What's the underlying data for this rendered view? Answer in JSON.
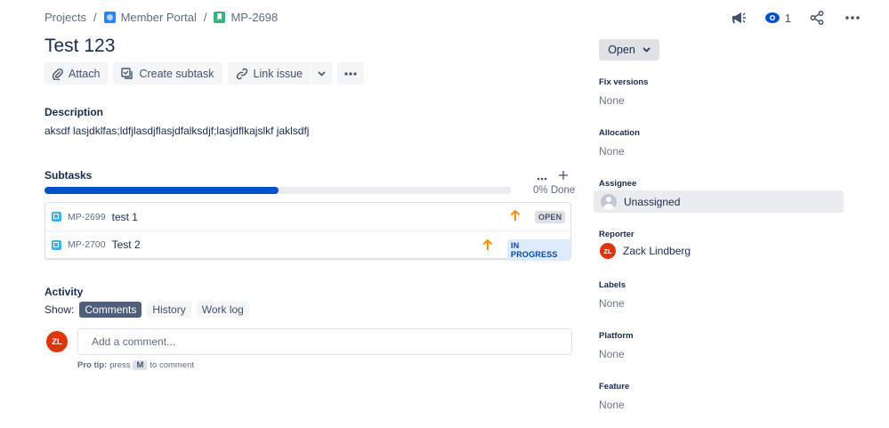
{
  "breadcrumb": {
    "projects": "Projects",
    "project": "Member Portal",
    "issue_key": "MP-2698"
  },
  "header": {
    "watch_count": "1"
  },
  "issue": {
    "title": "Test 123"
  },
  "toolbar": {
    "attach": "Attach",
    "create_subtask": "Create subtask",
    "link_issue": "Link issue"
  },
  "description": {
    "label": "Description",
    "text": "aksdf lasjdklfas;ldfjlasdjflasjdfalksdjf;lasjdflkajslkf jaklsdfj"
  },
  "subtasks": {
    "label": "Subtasks",
    "done_text": "0% Done",
    "progress_fraction": 0.5,
    "items": [
      {
        "key": "MP-2699",
        "summary": "test 1",
        "status": "OPEN",
        "priority": "high",
        "status_color": "#42526E",
        "status_bg": "#DFE1E6"
      },
      {
        "key": "MP-2700",
        "summary": "Test 2",
        "status": "IN PROGRESS",
        "priority": "high",
        "status_color": "#0747A6",
        "status_bg": "#DEEBFF"
      }
    ]
  },
  "activity": {
    "label": "Activity",
    "show_label": "Show:",
    "filters": [
      "Comments",
      "History",
      "Work log"
    ],
    "active_filter": "Comments",
    "comment_placeholder": "Add a comment...",
    "user_initials": "ZL",
    "protip_label": "Pro tip:",
    "protip_press": "press",
    "protip_key": "M",
    "protip_suffix": "to comment"
  },
  "sidebar": {
    "status": "Open",
    "fields": {
      "fix_versions": {
        "label": "Fix versions",
        "value": "None"
      },
      "allocation": {
        "label": "Allocation",
        "value": "None"
      },
      "assignee": {
        "label": "Assignee",
        "value": "Unassigned"
      },
      "reporter": {
        "label": "Reporter",
        "value": "Zack Lindberg",
        "initials": "ZL"
      },
      "labels": {
        "label": "Labels",
        "value": "None"
      },
      "platform": {
        "label": "Platform",
        "value": "None"
      },
      "feature": {
        "label": "Feature",
        "value": "None"
      }
    }
  },
  "colors": {
    "accent": "#0052CC",
    "priority_high": "#FF8B00",
    "avatar": "#DE350B"
  }
}
